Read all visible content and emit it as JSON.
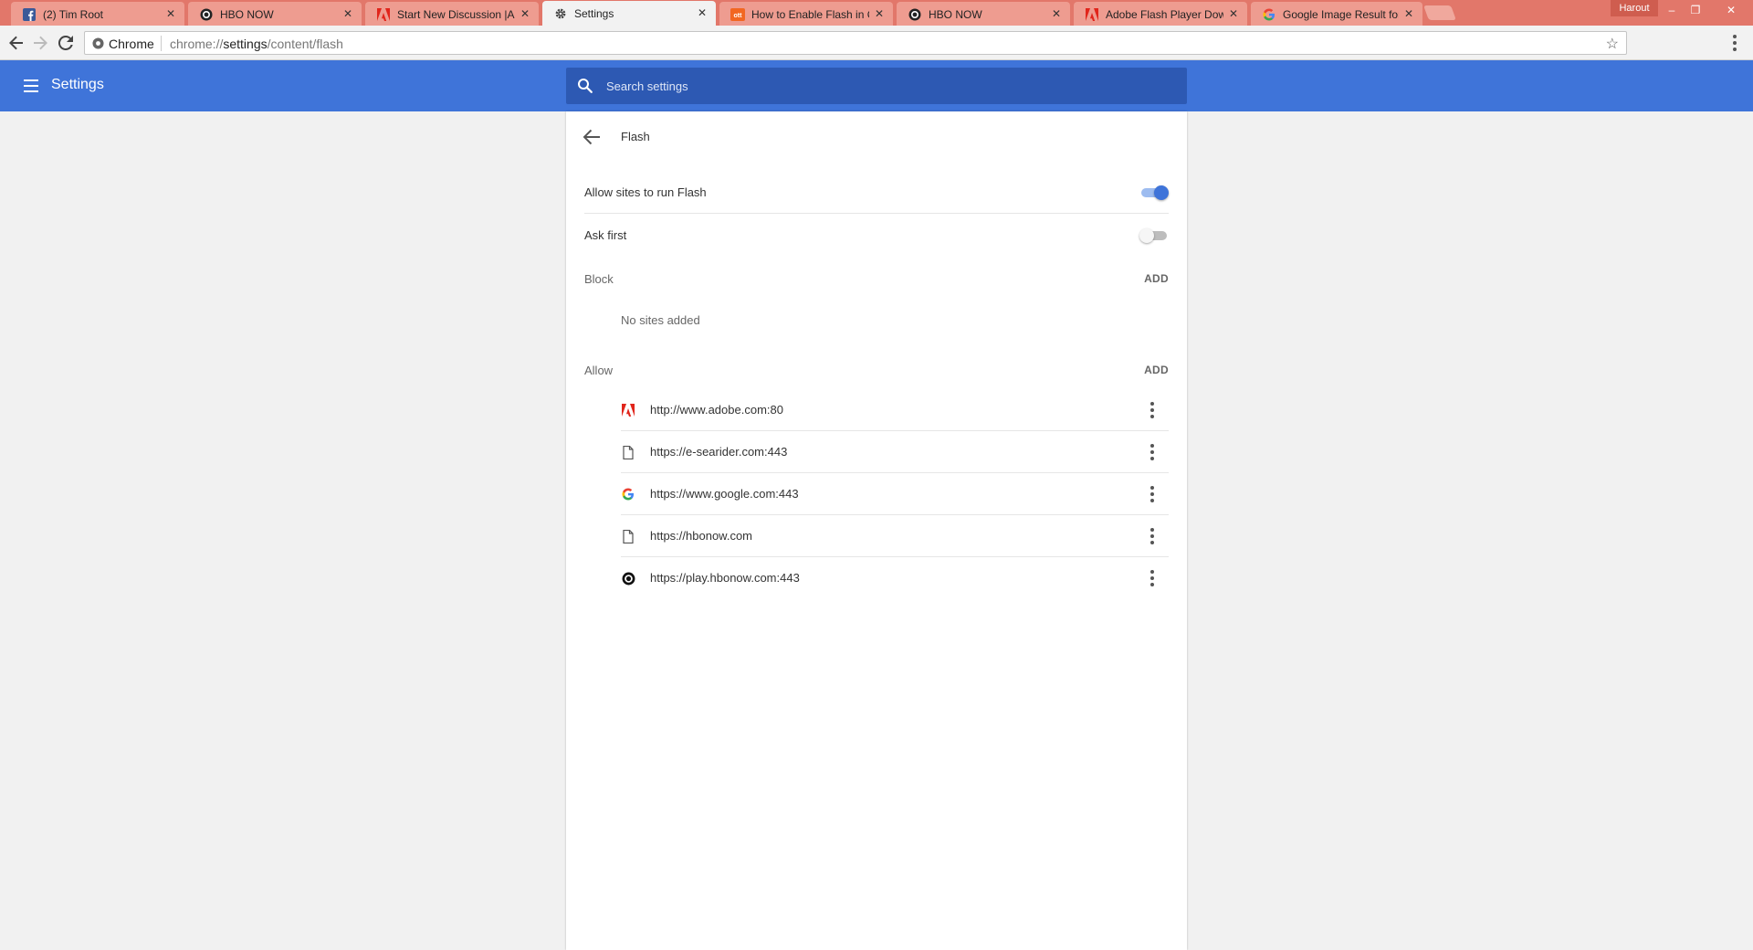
{
  "browser": {
    "tabs": [
      {
        "title": "(2) Tim Root",
        "icon": "facebook-icon"
      },
      {
        "title": "HBO NOW",
        "icon": "hbo-icon"
      },
      {
        "title": "Start New Discussion |Ad",
        "icon": "adobe-icon"
      },
      {
        "title": "Settings",
        "icon": "gear-icon",
        "active": true
      },
      {
        "title": "How to Enable Flash in C",
        "icon": "ott-icon"
      },
      {
        "title": "HBO NOW",
        "icon": "hbo-icon"
      },
      {
        "title": "Adobe Flash Player Dow",
        "icon": "adobe-icon"
      },
      {
        "title": "Google Image Result for",
        "icon": "google-icon"
      }
    ],
    "close_glyph": "✕",
    "profile_name": "Harout",
    "window_controls": {
      "minimize": "–",
      "restore": "❐",
      "close": "✕"
    },
    "omnibox": {
      "chip": "Chrome",
      "url_prefix": "chrome://",
      "url_host": "settings",
      "url_path": "/content/flash"
    },
    "colors": {
      "tabstrip": "#e2776a",
      "accent": "#3f74d9"
    }
  },
  "settings": {
    "header_title": "Settings",
    "search_placeholder": "Search settings"
  },
  "flash_page": {
    "title": "Flash",
    "allow_toggle": {
      "label": "Allow sites to run Flash",
      "enabled": true
    },
    "ask_toggle": {
      "label": "Ask first",
      "enabled": false
    },
    "block": {
      "heading": "Block",
      "add_label": "ADD",
      "empty_text": "No sites added"
    },
    "allow": {
      "heading": "Allow",
      "add_label": "ADD",
      "sites": [
        {
          "url": "http://www.adobe.com:80",
          "icon": "adobe-icon"
        },
        {
          "url": "https://e-searider.com:443",
          "icon": "page-icon"
        },
        {
          "url": "https://www.google.com:443",
          "icon": "google-icon"
        },
        {
          "url": "https://hbonow.com",
          "icon": "page-icon"
        },
        {
          "url": "https://play.hbonow.com:443",
          "icon": "hbo-icon"
        }
      ]
    }
  }
}
